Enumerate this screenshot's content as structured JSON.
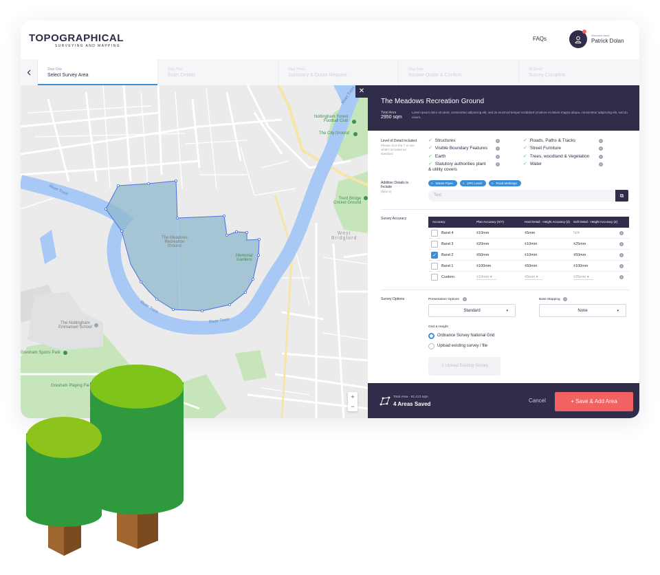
{
  "header": {
    "logo_main": "TOPOGRAPHICAL",
    "logo_sub": "SURVEYING AND MAPPING",
    "faqs": "FAQs",
    "welcome": "Welcome back,",
    "user_name": "Patrick Dolan"
  },
  "steps": [
    {
      "num": "Step One",
      "label": "Select Survey Area"
    },
    {
      "num": "Step Two",
      "label": "Enter Details"
    },
    {
      "num": "Step Three",
      "label": "Summary & Quote Request"
    },
    {
      "num": "Step Four",
      "label": "Review Quote & Confirm"
    },
    {
      "num": "All Done!",
      "label": "Survey Complete"
    }
  ],
  "map": {
    "labels": {
      "meadows": "The Meadows\nRecreation\nGround",
      "memorial": "Memorial\nGardens",
      "forest": "Nottingham Forest\nFootball Club",
      "city_ground": "The City Ground",
      "trent_bridge": "Trent Bridge\nCricket Ground",
      "west_bridgford": "West\nBridgford",
      "school": "The Nottingham\nEmmanuel School",
      "gresham_park": "Gresham Sports Park",
      "gresham_playing": "Gresham Playing Fie",
      "river_trent_1": "River Trent",
      "river_trent_2": "River Trent",
      "river_trent_3": "River Trent",
      "river_trent_4": "River Trent"
    },
    "zoom_in": "+",
    "zoom_out": "−"
  },
  "panel": {
    "close": "✕",
    "area_title": "The Meadows Recreation Ground",
    "total_area_label": "Total Area",
    "total_area_value": "2950 sqm",
    "description": "Lorem ipsum dolor sit amet, consectetur adipiscing elit, sed do eiusmod tempor incididunt ut labore et dolore magna aliqua, consectetur adipiscing elit, sed do eiusm..",
    "lod_label": "Level of Detail Included",
    "lod_note": "Please click the 'i' to see what's included as standard",
    "lod_items_left": [
      "Structures",
      "Visible Boundary Features",
      "Earth",
      "Statutory authorities plant\n& utility covers"
    ],
    "lod_items_right": [
      "Roads, Paths & Tracks",
      "Street Furniture",
      "Trees, woodland & Vegetation",
      "Water"
    ],
    "addition_label": "Addition Details to Include",
    "addition_note": "(Max 5)",
    "chips": [
      "Waste Pipes",
      "DPC Level",
      "Road Markings"
    ],
    "text_placeholder": "Text",
    "accuracy_label": "Survey Accuracy",
    "accuracy_headers": [
      "Accuracy",
      "Plan Accuracy (X/Y)",
      "Hard Detail - Height Accuracy (Z)",
      "Soft Detail - Height Accuracy (Z)"
    ],
    "accuracy_rows": [
      {
        "band": "Band 4",
        "plan": "±10mm",
        "hard": "±5mm",
        "soft": "N/A",
        "checked": false
      },
      {
        "band": "Band 3",
        "plan": "±20mm",
        "hard": "±10mm",
        "soft": "±25mm",
        "checked": false
      },
      {
        "band": "Band 2",
        "plan": "±50mm",
        "hard": "±10mm",
        "soft": "±50mm",
        "checked": true
      },
      {
        "band": "Band 1",
        "plan": "±100mm",
        "hard": "±50mm",
        "soft": "±100mm",
        "checked": false
      },
      {
        "band": "Custom",
        "plan": "±10mm",
        "hard": "±5mm",
        "soft": "±25mm",
        "checked": false
      }
    ],
    "survey_options_label": "Survey Options",
    "presentation_label": "Presentation Options",
    "presentation_value": "Standard",
    "base_mapping_label": "Base Mapping",
    "base_mapping_value": "None",
    "grid_height_label": "Grid & Height",
    "radio_1": "Ordnance Survey National Grid",
    "radio_2": "Upload existing survey / file",
    "upload_button": "Upload Existing Survey"
  },
  "footer": {
    "total_area": "Total Area - 61,413 sqm",
    "areas_saved": "4 Areas Saved",
    "cancel": "Cancel",
    "save": "+ Save & Add Area"
  },
  "colors": {
    "navy": "#2f2d4a",
    "accent_blue": "#3c8dd8",
    "save_red": "#f26262",
    "river": "#a8c8f5",
    "selection": "#8fb8cc"
  },
  "icons": {
    "back": "chevron-left-icon",
    "user": "user-icon",
    "close": "close-icon",
    "check": "check-icon",
    "info": "info-icon",
    "copy": "clipboard-icon",
    "upload": "upload-icon",
    "area": "polygon-icon"
  }
}
